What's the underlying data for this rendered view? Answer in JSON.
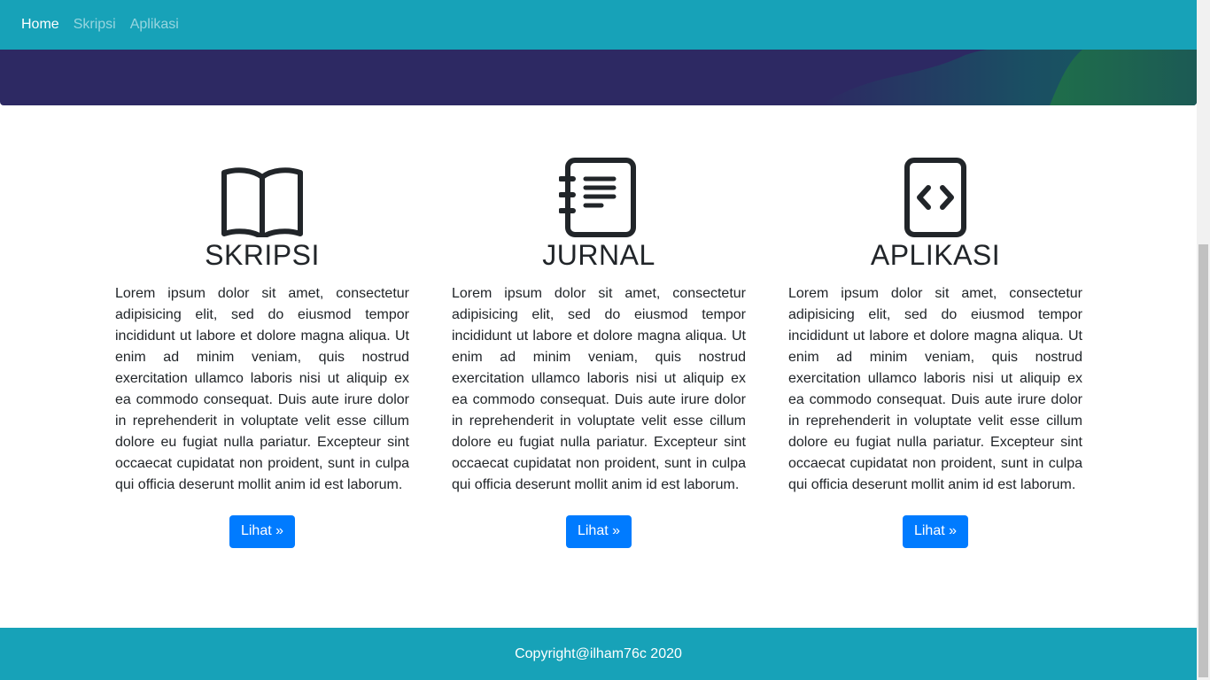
{
  "navbar": {
    "links": [
      {
        "label": "Home",
        "active": true
      },
      {
        "label": "Skripsi",
        "active": false
      },
      {
        "label": "Aplikasi",
        "active": false
      }
    ]
  },
  "colors": {
    "navbar": "#17a2b8",
    "hero": "#2d2963",
    "button": "#007bff",
    "footer": "#17a2b8"
  },
  "cards": [
    {
      "icon": "book-icon",
      "title": "SKRIPSI",
      "text": "Lorem ipsum dolor sit amet, consectetur adipisicing elit, sed do eiusmod tempor incididunt ut labore et dolore magna aliqua. Ut enim ad minim veniam, quis nostrud exercitation ullamco laboris nisi ut aliquip ex ea commodo consequat. Duis aute irure dolor in reprehenderit in voluptate velit esse cillum dolore eu fugiat nulla pariatur. Excepteur sint occaecat cupidatat non proident, sunt in culpa qui officia deserunt mollit anim id est laborum.",
      "button": "Lihat »"
    },
    {
      "icon": "journal-icon",
      "title": "JURNAL",
      "text": "Lorem ipsum dolor sit amet, consectetur adipisicing elit, sed do eiusmod tempor incididunt ut labore et dolore magna aliqua. Ut enim ad minim veniam, quis nostrud exercitation ullamco laboris nisi ut aliquip ex ea commodo consequat. Duis aute irure dolor in reprehenderit in voluptate velit esse cillum dolore eu fugiat nulla pariatur. Excepteur sint occaecat cupidatat non proident, sunt in culpa qui officia deserunt mollit anim id est laborum.",
      "button": "Lihat »"
    },
    {
      "icon": "code-file-icon",
      "title": "APLIKASI",
      "text": "Lorem ipsum dolor sit amet, consectetur adipisicing elit, sed do eiusmod tempor incididunt ut labore et dolore magna aliqua. Ut enim ad minim veniam, quis nostrud exercitation ullamco laboris nisi ut aliquip ex ea commodo consequat. Duis aute irure dolor in reprehenderit in voluptate velit esse cillum dolore eu fugiat nulla pariatur. Excepteur sint occaecat cupidatat non proident, sunt in culpa qui officia deserunt mollit anim id est laborum.",
      "button": "Lihat »"
    }
  ],
  "footer": {
    "text": "Copyright@ilham76c 2020"
  }
}
